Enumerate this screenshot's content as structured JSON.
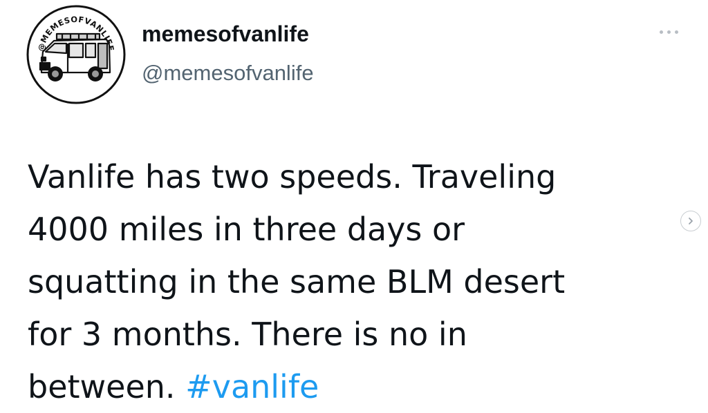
{
  "profile": {
    "avatar_text": "@MEMESOFVANLIFE",
    "display_name": "memesofvanlife",
    "handle": "@memesofvanlife"
  },
  "tweet": {
    "lines": [
      "Vanlife has two speeds. Traveling",
      "4000 miles in three days or",
      "squatting in the same BLM desert",
      "for 3 months. There is no in",
      "between."
    ],
    "hashtag": "#vanlife"
  },
  "colors": {
    "text": "#0f1419",
    "secondary": "#536471",
    "link": "#1d9bf0"
  },
  "icons": {
    "more": "more-horizontal-icon",
    "next": "chevron-right-icon"
  }
}
